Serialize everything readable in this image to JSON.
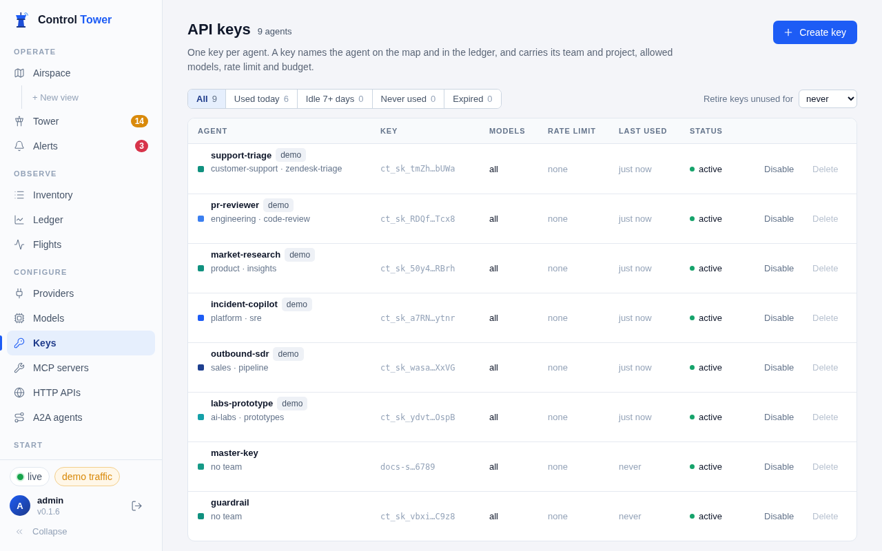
{
  "sidebar": {
    "brand": {
      "name": "Control",
      "accent": "Tower"
    },
    "sections": [
      {
        "heading": "OPERATE",
        "items": [
          {
            "label": "Airspace",
            "selected": false,
            "children": [
              {
                "label": "+ New view",
                "selected": false
              }
            ]
          },
          {
            "label": "Tower",
            "selected": false,
            "badge": {
              "text": "14",
              "color": "#d98a0b"
            }
          },
          {
            "label": "Alerts",
            "selected": false,
            "badge": {
              "text": "3",
              "color": "#d7344a"
            }
          }
        ]
      },
      {
        "heading": "OBSERVE",
        "items": [
          {
            "label": "Inventory",
            "selected": false
          },
          {
            "label": "Ledger",
            "selected": false
          },
          {
            "label": "Flights",
            "selected": false
          }
        ]
      },
      {
        "heading": "CONFIGURE",
        "items": [
          {
            "label": "Providers",
            "selected": false
          },
          {
            "label": "Models",
            "selected": false
          },
          {
            "label": "Keys",
            "selected": true
          },
          {
            "label": "MCP servers",
            "selected": false
          },
          {
            "label": "HTTP APIs",
            "selected": false
          },
          {
            "label": "A2A agents",
            "selected": false
          }
        ]
      },
      {
        "heading": "START"
      }
    ],
    "status_pills": [
      {
        "label": "live",
        "kind": "live"
      },
      {
        "label": "demo traffic",
        "kind": "demo"
      }
    ],
    "user": {
      "initial": "A",
      "name": "admin",
      "version": "v0.1.6"
    },
    "collapse": "Collapse"
  },
  "header": {
    "title": "API keys",
    "count": "9 agents",
    "description": "One key per agent. A key names the agent on the map and in the ledger, and carries its team and project, allowed models, rate limit and budget.",
    "create_button": "Create key"
  },
  "filters": [
    {
      "label": "All",
      "count": "9",
      "selected": true
    },
    {
      "label": "Used today",
      "count": "6",
      "selected": false
    },
    {
      "label": "Idle 7+ days",
      "count": "0",
      "selected": false
    },
    {
      "label": "Never used",
      "count": "0",
      "selected": false
    },
    {
      "label": "Expired",
      "count": "0",
      "selected": false
    }
  ],
  "retire": {
    "label": "Retire keys unused for",
    "value": "never"
  },
  "table": {
    "columns": [
      "AGENT",
      "KEY",
      "MODELS",
      "RATE LIMIT",
      "LAST USED",
      "STATUS"
    ],
    "rows": [
      {
        "name": "support-triage",
        "tag": "demo",
        "meta": "customer-support · zendesk-triage",
        "color": "#10917f",
        "key": "ct_sk_tmZh…bUWa",
        "models": "all",
        "rate_limit": "none",
        "last_used": "just now",
        "status": "active",
        "actions": [
          {
            "label": "Disable",
            "disabled": false
          },
          {
            "label": "Delete",
            "disabled": true
          }
        ]
      },
      {
        "name": "pr-reviewer",
        "tag": "demo",
        "meta": "engineering · code-review",
        "color": "#3b7ff0",
        "key": "ct_sk_RDQf…Tcx8",
        "models": "all",
        "rate_limit": "none",
        "last_used": "just now",
        "status": "active",
        "actions": [
          {
            "label": "Disable",
            "disabled": false
          },
          {
            "label": "Delete",
            "disabled": true
          }
        ]
      },
      {
        "name": "market-research",
        "tag": "demo",
        "meta": "product · insights",
        "color": "#10917f",
        "key": "ct_sk_50y4…RBrh",
        "models": "all",
        "rate_limit": "none",
        "last_used": "just now",
        "status": "active",
        "actions": [
          {
            "label": "Disable",
            "disabled": false
          },
          {
            "label": "Delete",
            "disabled": true
          }
        ]
      },
      {
        "name": "incident-copilot",
        "tag": "demo",
        "meta": "platform · sre",
        "color": "#1d5cf5",
        "key": "ct_sk_a7RN…ytnr",
        "models": "all",
        "rate_limit": "none",
        "last_used": "just now",
        "status": "active",
        "actions": [
          {
            "label": "Disable",
            "disabled": false
          },
          {
            "label": "Delete",
            "disabled": true
          }
        ]
      },
      {
        "name": "outbound-sdr",
        "tag": "demo",
        "meta": "sales · pipeline",
        "color": "#1e3f8f",
        "key": "ct_sk_wasa…XxVG",
        "models": "all",
        "rate_limit": "none",
        "last_used": "just now",
        "status": "active",
        "actions": [
          {
            "label": "Disable",
            "disabled": false
          },
          {
            "label": "Delete",
            "disabled": true
          }
        ]
      },
      {
        "name": "labs-prototype",
        "tag": "demo",
        "meta": "ai-labs · prototypes",
        "color": "#14a0a8",
        "key": "ct_sk_ydvt…OspB",
        "models": "all",
        "rate_limit": "none",
        "last_used": "just now",
        "status": "active",
        "actions": [
          {
            "label": "Disable",
            "disabled": false
          },
          {
            "label": "Delete",
            "disabled": true
          }
        ]
      },
      {
        "name": "master-key",
        "meta": "no team",
        "color": "#169a87",
        "key": "docs-s…6789",
        "models": "all",
        "rate_limit": "none",
        "last_used": "never",
        "status": "active",
        "actions": [
          {
            "label": "Disable",
            "disabled": false
          },
          {
            "label": "Delete",
            "disabled": true
          }
        ]
      },
      {
        "name": "guardrail",
        "meta": "no team",
        "color": "#10917f",
        "key": "ct_sk_vbxi…C9z8",
        "models": "all",
        "rate_limit": "none",
        "last_used": "never",
        "status": "active",
        "actions": [
          {
            "label": "Disable",
            "disabled": false
          },
          {
            "label": "Delete",
            "disabled": true
          }
        ]
      }
    ]
  }
}
